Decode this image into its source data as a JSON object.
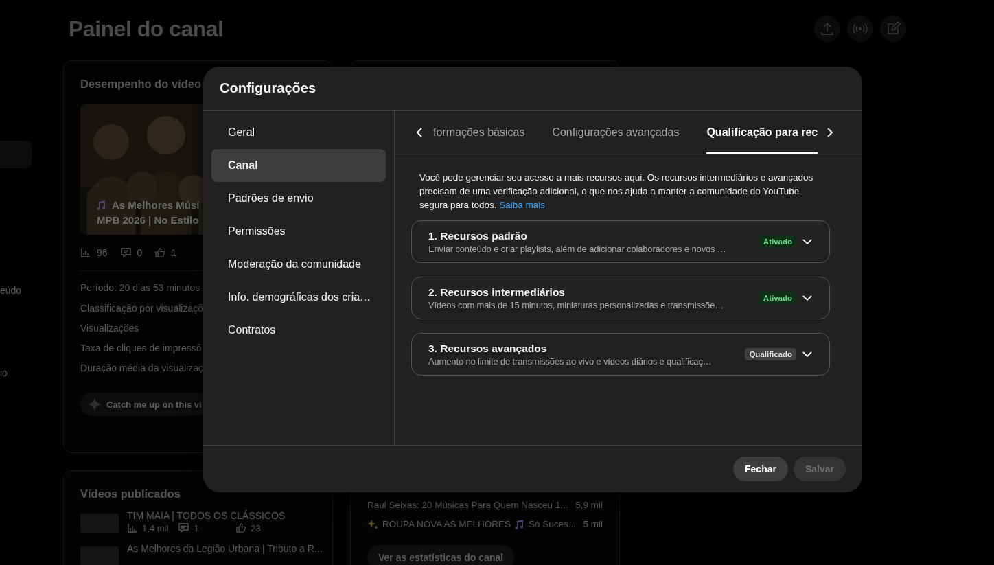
{
  "page": {
    "title": "Painel do canal"
  },
  "sidebar_fragments": [
    "eúdo",
    "io"
  ],
  "video_performance": {
    "title": "Desempenho do vídeo",
    "thumbnail_title": [
      "As Melhores Músi",
      "MPB 2026 | No Estilo"
    ],
    "stats": [
      "96",
      "0",
      "1"
    ],
    "period": "Período: 20 dias 53 minutos",
    "metrics": [
      "Classificação por visualizaçõ",
      "Visualizações",
      "Taxa de cliques de impressõ",
      "Duração média da visualizaç"
    ],
    "ai_button": "Catch me up on this vi"
  },
  "published_videos": {
    "title": "Vídeos publicados",
    "videos": [
      {
        "title": "TIM MAIA | TODOS OS CLÁSSICOS",
        "views": "1,4 mil",
        "comments": "1",
        "likes": "23"
      },
      {
        "title": "As Melhores da Legião Urbana | Tributo a R..."
      }
    ]
  },
  "top_videos": {
    "rows": [
      {
        "title": "Raul Seixas: 20 Músicas Para Quem Nasceu 1...",
        "views": "5,9 mil"
      },
      {
        "title": "ROUPA NOVA AS MELHORES",
        "title_end": "Só Suces...",
        "views": "5 mil"
      }
    ],
    "button": "Ver as estatísticas do canal"
  },
  "dialog": {
    "title": "Configurações",
    "nav": [
      {
        "label": "Geral",
        "selected": false
      },
      {
        "label": "Canal",
        "selected": true
      },
      {
        "label": "Padrões de envio",
        "selected": false
      },
      {
        "label": "Permissões",
        "selected": false
      },
      {
        "label": "Moderação da comunidade",
        "selected": false
      },
      {
        "label": "Info. demográficas dos cria…",
        "selected": false
      },
      {
        "label": "Contratos",
        "selected": false
      }
    ],
    "tabs": [
      {
        "label": "formações básicas",
        "selected": false
      },
      {
        "label": "Configurações avançadas",
        "selected": false
      },
      {
        "label": "Qualificação para rec",
        "selected": true
      }
    ],
    "intro": "Você pode gerenciar seu acesso a mais recursos aqui. Os recursos intermediários e avançados precisam de uma verificação adicional, o que nos ajuda a manter a comunidade do YouTube segura para todos.",
    "link": "Saiba mais",
    "features": [
      {
        "title": "1. Recursos padrão",
        "description": "Enviar conteúdo e criar playlists, além de adicionar colaboradores e novos …",
        "status": "Ativado",
        "kind": "enabled",
        "expanded": false
      },
      {
        "title": "2. Recursos intermediários",
        "description": "Vídeos com mais de 15 minutos, miniaturas personalizadas e transmissõe…",
        "status": "Ativado",
        "kind": "enabled",
        "expanded": false
      },
      {
        "title": "3. Recursos avançados",
        "description": "Aumento no limite de transmissões ao vivo e vídeos diários e qualificaç…",
        "status": "Qualificado",
        "kind": "qualified",
        "expanded": false
      }
    ],
    "buttons": [
      {
        "label": "Fechar",
        "disabled": false
      },
      {
        "label": "Salvar",
        "disabled": true
      }
    ]
  }
}
